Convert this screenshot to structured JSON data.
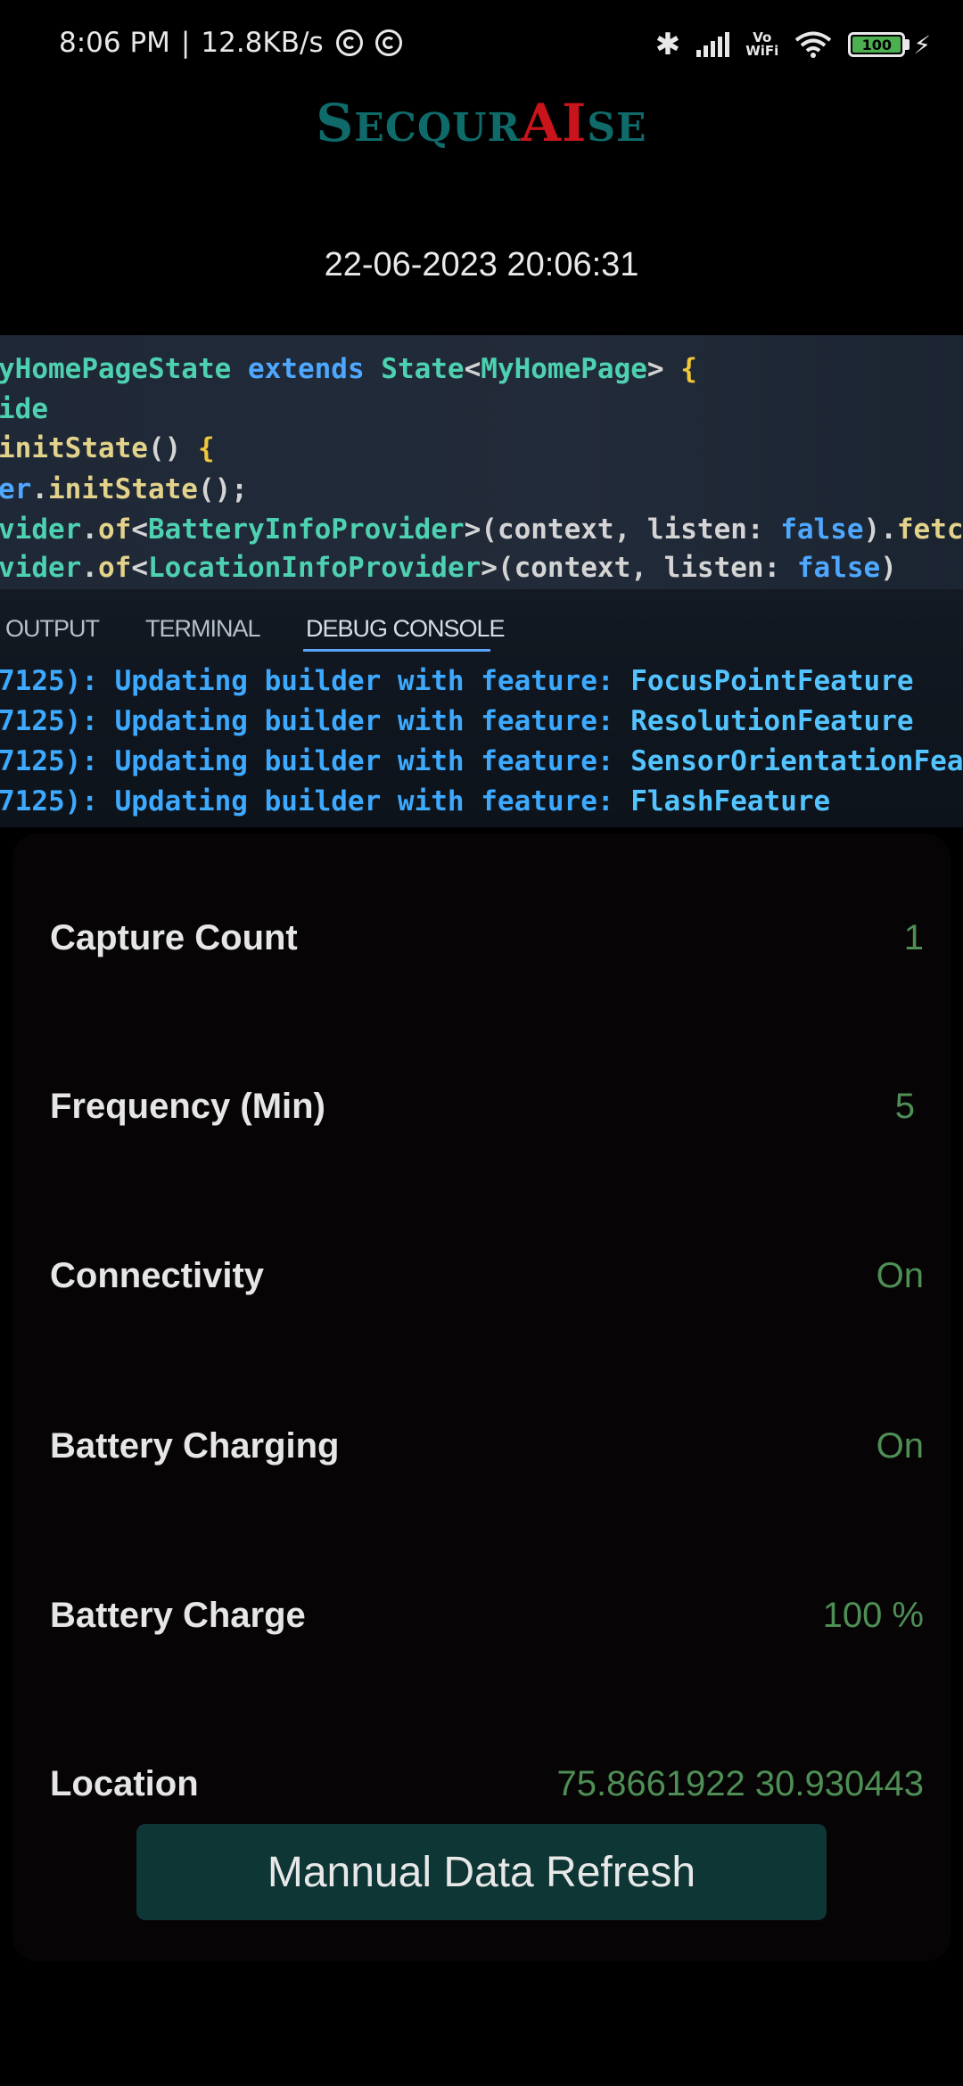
{
  "status_bar": {
    "time": "8:06 PM",
    "separator": "|",
    "speed": "12.8KB/s",
    "battery_level": "100",
    "vowifi_top": "Vo",
    "vowifi_bottom": "WiFi",
    "bluetooth_glyph": "✱"
  },
  "header": {
    "logo_parts": [
      "S",
      "ECQUR",
      "AI",
      "SE"
    ],
    "datetime": "22-06-2023 20:06:31"
  },
  "capture_image": {
    "code_lines": [
      {
        "segments": [
          {
            "t": "yHomePageState ",
            "c": "cls"
          },
          {
            "t": "extends ",
            "c": "kw"
          },
          {
            "t": "State",
            "c": "cls"
          },
          {
            "t": "<",
            "c": "pl"
          },
          {
            "t": "MyHomePage",
            "c": "cls"
          },
          {
            "t": "> ",
            "c": "pl"
          },
          {
            "t": "{",
            "c": "br"
          }
        ]
      },
      {
        "segments": [
          {
            "t": "ide",
            "c": "cls"
          }
        ]
      },
      {
        "segments": [
          {
            "t": "initState",
            "c": "fn"
          },
          {
            "t": "() ",
            "c": "pl"
          },
          {
            "t": "{",
            "c": "br"
          }
        ]
      },
      {
        "segments": [
          {
            "t": "er",
            "c": "kw"
          },
          {
            "t": ".",
            "c": "pl"
          },
          {
            "t": "initState",
            "c": "fn"
          },
          {
            "t": "();",
            "c": "pl"
          }
        ]
      },
      {
        "segments": [
          {
            "t": "vider",
            "c": "cls"
          },
          {
            "t": ".",
            "c": "pl"
          },
          {
            "t": "of",
            "c": "fn"
          },
          {
            "t": "<",
            "c": "pl"
          },
          {
            "t": "BatteryInfoProvider",
            "c": "cls"
          },
          {
            "t": ">(context, listen: ",
            "c": "pl"
          },
          {
            "t": "false",
            "c": "kw"
          },
          {
            "t": ").",
            "c": "pl"
          },
          {
            "t": "fetchBa",
            "c": "fn"
          }
        ]
      },
      {
        "segments": [
          {
            "t": "vider",
            "c": "cls"
          },
          {
            "t": ".",
            "c": "pl"
          },
          {
            "t": "of",
            "c": "fn"
          },
          {
            "t": "<",
            "c": "pl"
          },
          {
            "t": "LocationInfoProvider",
            "c": "cls"
          },
          {
            "t": ">(context, listen: ",
            "c": "pl"
          },
          {
            "t": "false",
            "c": "kw"
          },
          {
            "t": ")",
            "c": "pl"
          }
        ]
      }
    ],
    "tabs": [
      "OUTPUT",
      "TERMINAL",
      "DEBUG CONSOLE"
    ],
    "console_lines": [
      {
        "prefix": "7125): Updating builder with feature: ",
        "feature": "FocusPointFeature"
      },
      {
        "prefix": "7125): Updating builder with feature: ",
        "feature": "ResolutionFeature"
      },
      {
        "prefix": "7125): Updating builder with feature: ",
        "feature": "SensorOrientationFeatur"
      },
      {
        "prefix": "7125): Updating builder with feature: ",
        "feature": "FlashFeature"
      }
    ]
  },
  "info": {
    "rows": [
      {
        "label": "Capture Count",
        "value": "1"
      },
      {
        "label": "Frequency (Min)",
        "value": "5"
      },
      {
        "label": "Connectivity",
        "value": "On"
      },
      {
        "label": "Battery Charging",
        "value": "On"
      },
      {
        "label": "Battery Charge",
        "value": "100 %"
      },
      {
        "label": "Location",
        "value": "75.8661922 30.930443"
      }
    ],
    "refresh_button": "Mannual Data Refresh"
  },
  "colors": {
    "logo_teal": "#0f6a6a",
    "logo_red": "#c8141a",
    "value_green": "#4e8f55",
    "button_bg": "#0e3634"
  }
}
